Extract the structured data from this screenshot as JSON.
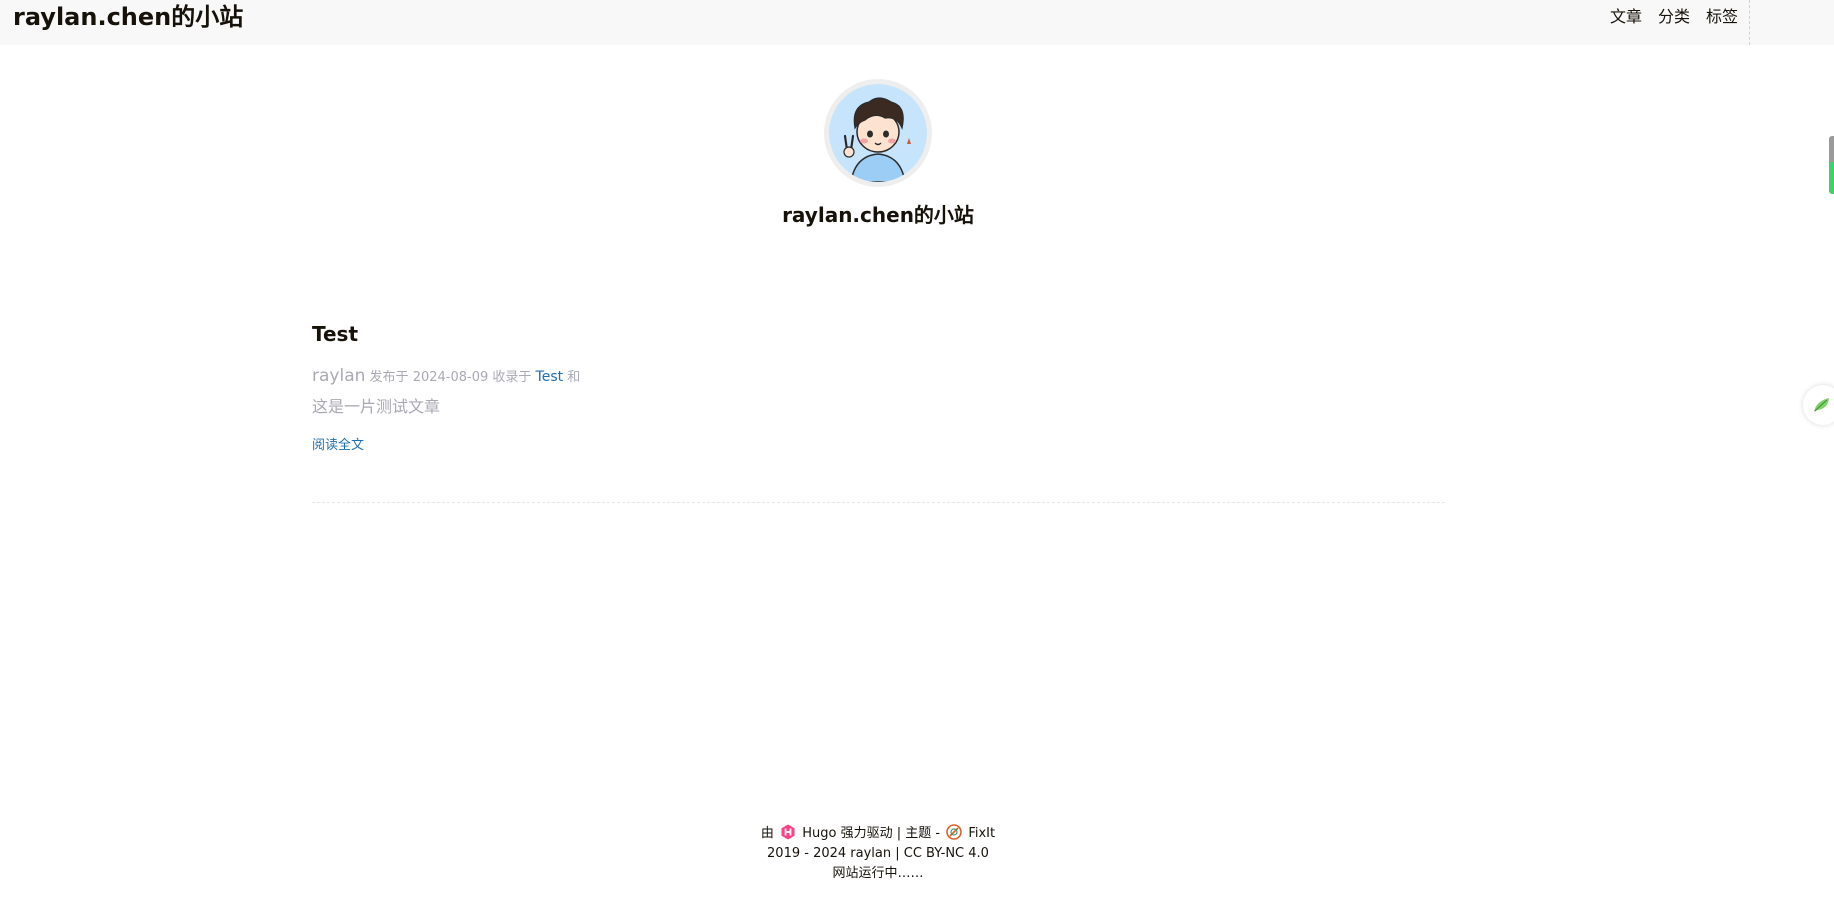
{
  "header": {
    "site_title": "raylan.chen的小站",
    "menu": [
      {
        "label": "文章"
      },
      {
        "label": "分类"
      },
      {
        "label": "标签"
      }
    ]
  },
  "profile": {
    "avatar_icon": "cartoon-avatar",
    "title": "raylan.chen的小站"
  },
  "post": {
    "title": "Test",
    "author": "raylan",
    "published_prefix": "发布于",
    "date": "2024-08-09",
    "category_prefix": "收录于",
    "category": "Test",
    "category_suffix": "和",
    "summary": "这是一片测试文章",
    "read_more": "阅读全文"
  },
  "footer": {
    "powered_prefix": "由",
    "hugo_label": "Hugo",
    "powered_suffix": "强力驱动 | 主题 -",
    "theme_label": "FixIt",
    "copyright": "2019 - 2024 raylan | CC BY-NC 4.0",
    "running": "网站运行中……"
  },
  "colors": {
    "link": "#1f6fae",
    "meta": "#a9a9b3",
    "header_bg": "#f8f8f8"
  }
}
